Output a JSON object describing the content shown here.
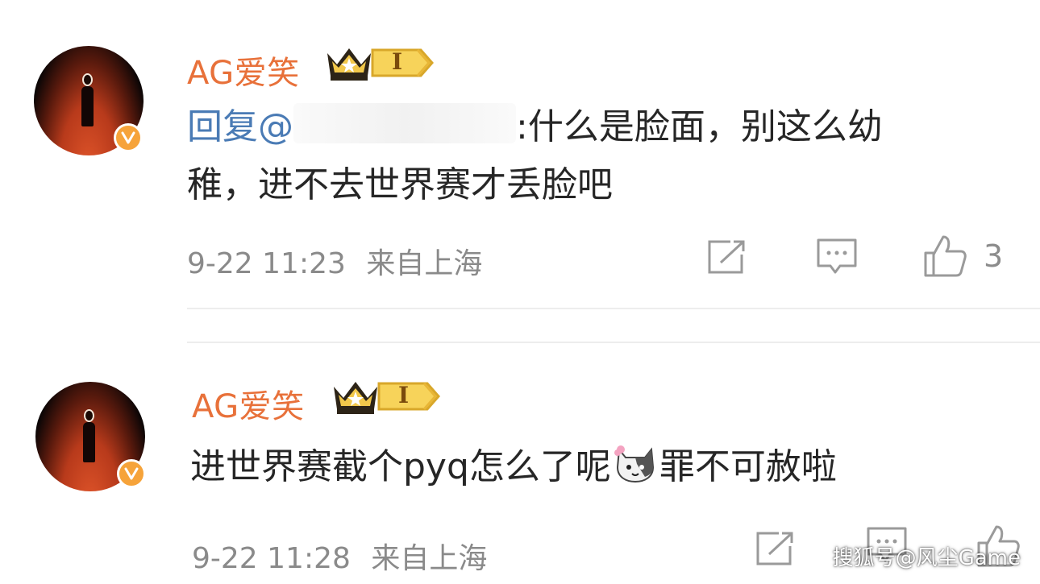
{
  "comments": [
    {
      "username": "AG爱笑",
      "rank_label": "I",
      "reply_prefix": "回复@",
      "text_after_mention": ":什么是脸面，别这么幼",
      "text_line2": "稚，进不去世界赛才丢脸吧",
      "timestamp": "9-22 11:23",
      "location": "来自上海",
      "like_count": "3"
    },
    {
      "username": "AG爱笑",
      "rank_label": "I",
      "text_before_emoji": "进世界赛截个pyq怎么了呢",
      "text_after_emoji": "罪不可赦啦",
      "timestamp": "9-22 11:28",
      "location": "来自上海",
      "like_count": ""
    }
  ],
  "icons": {
    "share": "share-icon",
    "reply": "comment-icon",
    "like": "thumbs-up-icon",
    "verified": "verified-v-badge-icon",
    "crown": "crown-icon",
    "emoji": "cat-face-emoji-icon"
  },
  "colors": {
    "username": "#e8713a",
    "mention": "#4a7bb5",
    "meta": "#8a8a8a",
    "verified_badge": "#f6a33a"
  },
  "watermark": "搜狐号@风尘Game"
}
